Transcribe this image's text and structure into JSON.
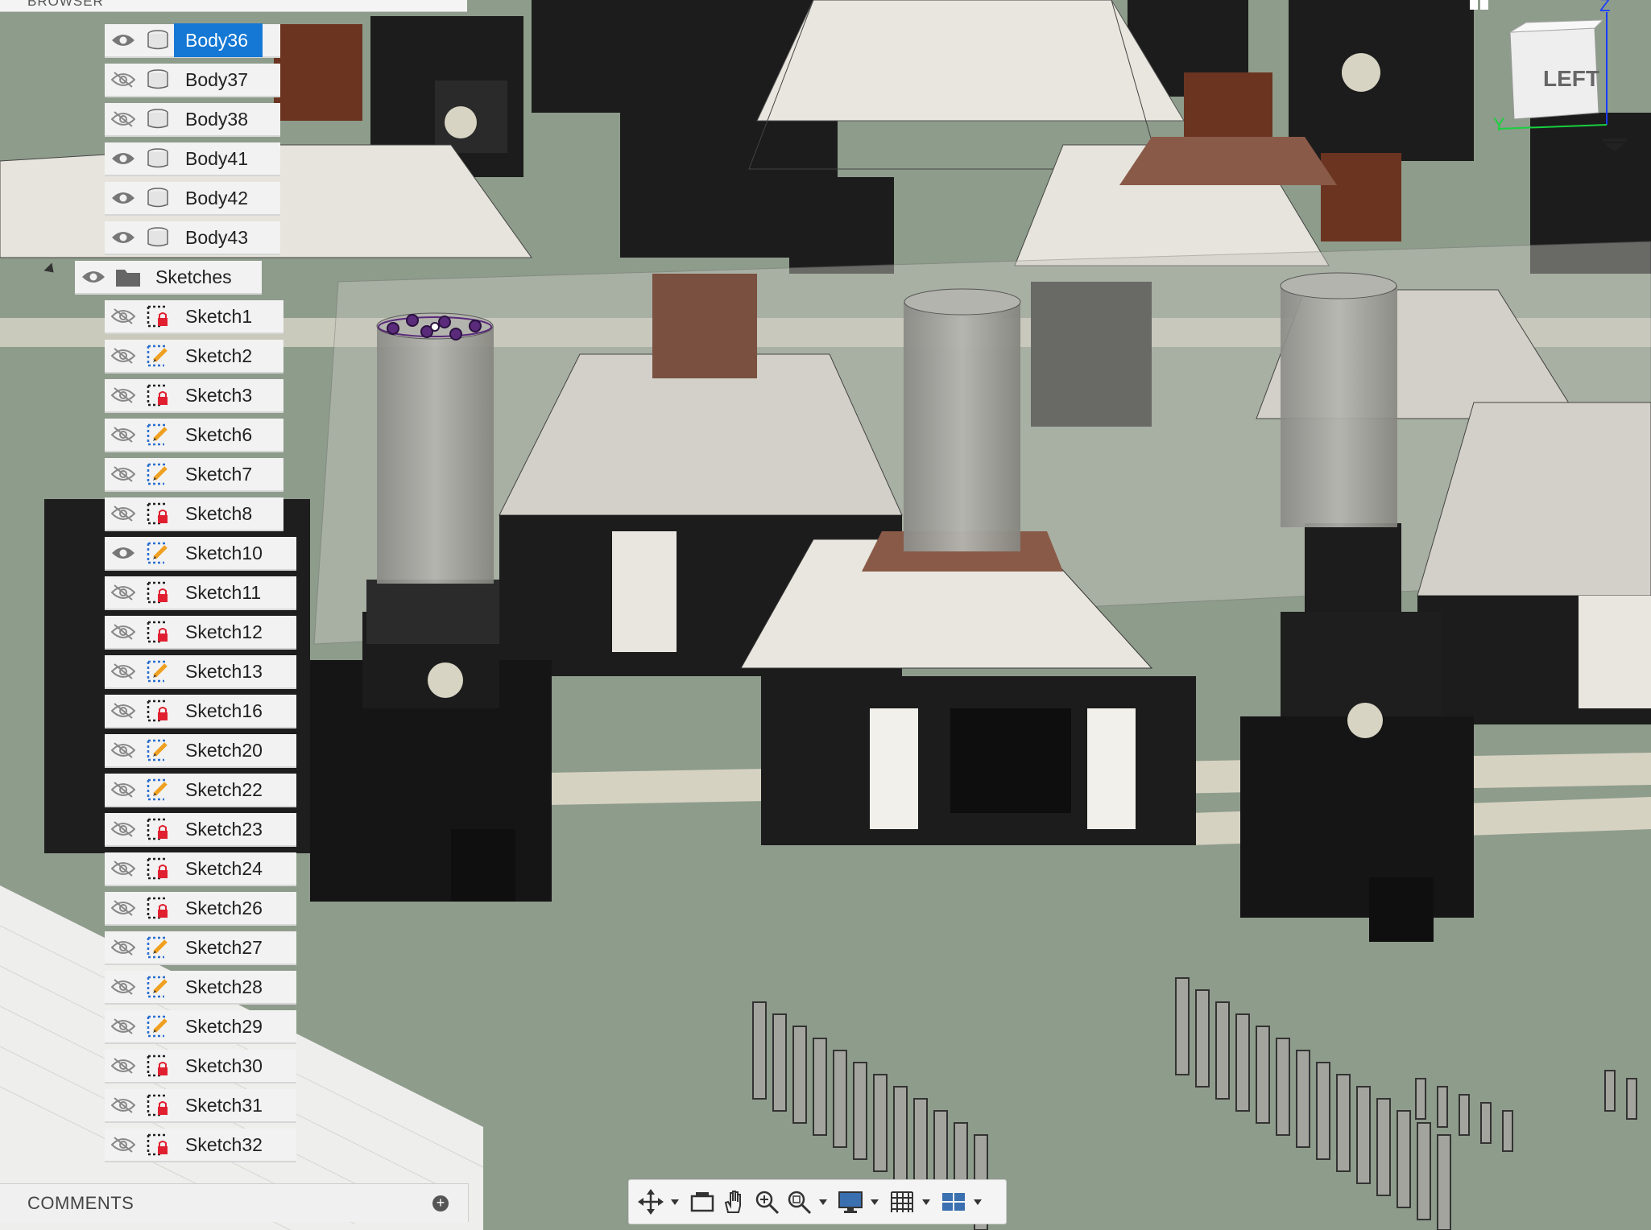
{
  "browser": {
    "header_label": "BROWSER",
    "bodies": [
      {
        "label": "Body36",
        "visible": true,
        "selected": true
      },
      {
        "label": "Body37",
        "visible": false
      },
      {
        "label": "Body38",
        "visible": false
      },
      {
        "label": "Body41",
        "visible": true
      },
      {
        "label": "Body42",
        "visible": true
      },
      {
        "label": "Body43",
        "visible": true
      }
    ],
    "sketches_folder": {
      "label": "Sketches",
      "visible": true
    },
    "sketches": [
      {
        "label": "Sketch1",
        "visible": false,
        "icon": "sketch-locked-icon"
      },
      {
        "label": "Sketch2",
        "visible": false,
        "icon": "sketch-edit-icon"
      },
      {
        "label": "Sketch3",
        "visible": false,
        "icon": "sketch-locked-icon"
      },
      {
        "label": "Sketch6",
        "visible": false,
        "icon": "sketch-edit-icon"
      },
      {
        "label": "Sketch7",
        "visible": false,
        "icon": "sketch-edit-icon"
      },
      {
        "label": "Sketch8",
        "visible": false,
        "icon": "sketch-locked-icon"
      },
      {
        "label": "Sketch10",
        "visible": true,
        "icon": "sketch-edit-icon"
      },
      {
        "label": "Sketch11",
        "visible": false,
        "icon": "sketch-locked-icon"
      },
      {
        "label": "Sketch12",
        "visible": false,
        "icon": "sketch-locked-icon"
      },
      {
        "label": "Sketch13",
        "visible": false,
        "icon": "sketch-edit-icon"
      },
      {
        "label": "Sketch16",
        "visible": false,
        "icon": "sketch-locked-icon"
      },
      {
        "label": "Sketch20",
        "visible": false,
        "icon": "sketch-edit-icon"
      },
      {
        "label": "Sketch22",
        "visible": false,
        "icon": "sketch-edit-icon"
      },
      {
        "label": "Sketch23",
        "visible": false,
        "icon": "sketch-locked-icon"
      },
      {
        "label": "Sketch24",
        "visible": false,
        "icon": "sketch-locked-icon"
      },
      {
        "label": "Sketch26",
        "visible": false,
        "icon": "sketch-locked-icon"
      },
      {
        "label": "Sketch27",
        "visible": false,
        "icon": "sketch-edit-icon"
      },
      {
        "label": "Sketch28",
        "visible": false,
        "icon": "sketch-edit-icon"
      },
      {
        "label": "Sketch29",
        "visible": false,
        "icon": "sketch-edit-icon"
      },
      {
        "label": "Sketch30",
        "visible": false,
        "icon": "sketch-locked-icon"
      },
      {
        "label": "Sketch31",
        "visible": false,
        "icon": "sketch-locked-icon"
      },
      {
        "label": "Sketch32",
        "visible": false,
        "icon": "sketch-locked-icon"
      }
    ]
  },
  "comments": {
    "label": "COMMENTS"
  },
  "viewcube": {
    "face_label": "LEFT",
    "axis_z": "Z",
    "axis_y": "Y"
  },
  "navbar": {
    "tools": [
      "orbit-icon",
      "look-at-icon",
      "pan-icon",
      "zoom-icon",
      "fit-icon",
      "display-settings-icon",
      "grid-icon",
      "viewports-icon"
    ]
  },
  "colors": {
    "selection": "#1478d4",
    "pcb": "#8e9c8b",
    "switch_housing": "#1c1c1c",
    "switch_top": "#e6e4dc",
    "stem": "#6b3420",
    "lock": "#e02030",
    "sketch_pencil": "#f0a020"
  }
}
